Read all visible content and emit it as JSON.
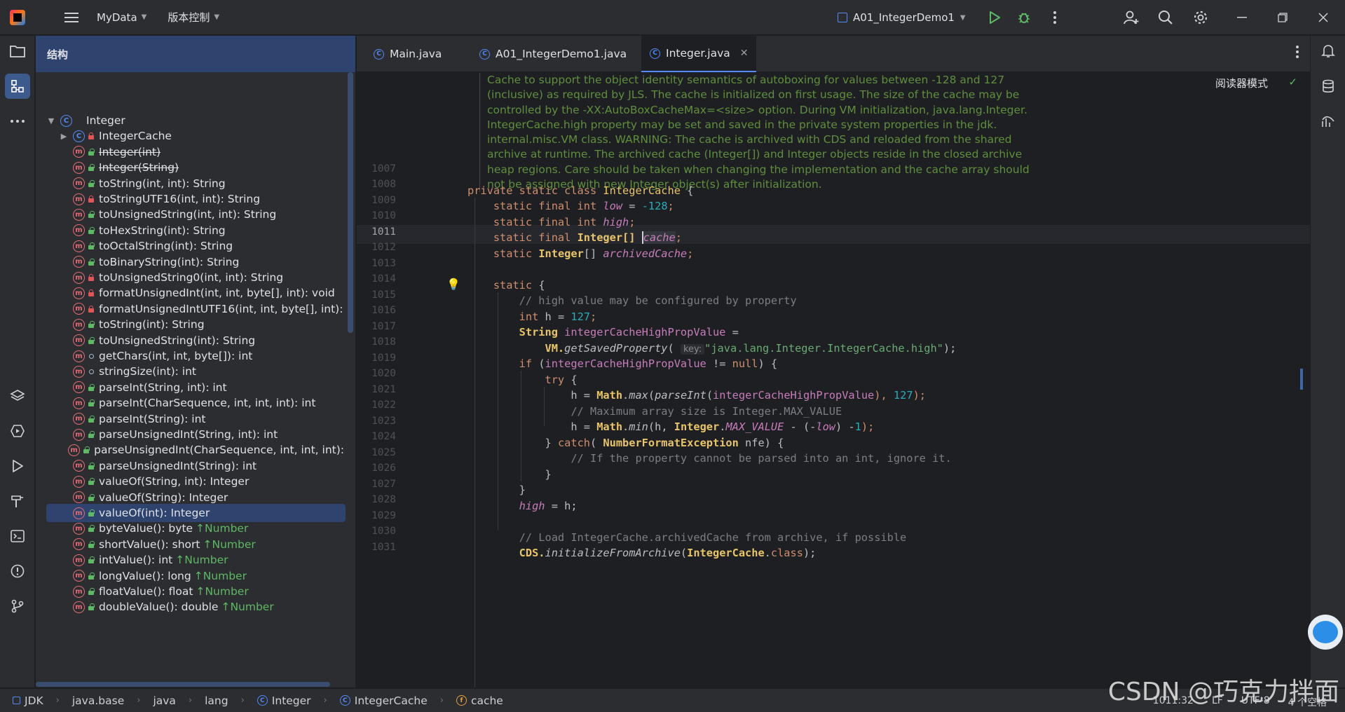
{
  "titlebar": {
    "project": "MyData",
    "vcs": "版本控制",
    "run_config": "A01_IntegerDemo1"
  },
  "structure": {
    "title": "结构",
    "items": [
      {
        "label": "Integer",
        "kind": "c",
        "vis": "",
        "arrow": "open",
        "indent": 0
      },
      {
        "label": "IntegerCache",
        "kind": "c",
        "vis": "priv",
        "arrow": "closed",
        "indent": 1
      },
      {
        "label": "Integer(int)",
        "kind": "m",
        "vis": "pub",
        "strike": true,
        "indent": 1
      },
      {
        "label": "Integer(String)",
        "kind": "m",
        "vis": "pub",
        "strike": true,
        "indent": 1
      },
      {
        "label": "toString(int, int): String",
        "kind": "m",
        "vis": "pub",
        "indent": 1
      },
      {
        "label": "toStringUTF16(int, int): String",
        "kind": "m",
        "vis": "priv",
        "indent": 1
      },
      {
        "label": "toUnsignedString(int, int): String",
        "kind": "m",
        "vis": "pub",
        "indent": 1
      },
      {
        "label": "toHexString(int): String",
        "kind": "m",
        "vis": "pub",
        "indent": 1
      },
      {
        "label": "toOctalString(int): String",
        "kind": "m",
        "vis": "pub",
        "indent": 1
      },
      {
        "label": "toBinaryString(int): String",
        "kind": "m",
        "vis": "pub",
        "indent": 1
      },
      {
        "label": "toUnsignedString0(int, int): String",
        "kind": "m",
        "vis": "priv",
        "indent": 1
      },
      {
        "label": "formatUnsignedInt(int, int, byte[], int): void",
        "kind": "m",
        "vis": "priv",
        "indent": 1
      },
      {
        "label": "formatUnsignedIntUTF16(int, int, byte[], int):",
        "kind": "m",
        "vis": "priv",
        "indent": 1
      },
      {
        "label": "toString(int): String",
        "kind": "m",
        "vis": "pub",
        "indent": 1
      },
      {
        "label": "toUnsignedString(int): String",
        "kind": "m",
        "vis": "pub",
        "indent": 1
      },
      {
        "label": "getChars(int, int, byte[]): int",
        "kind": "m",
        "vis": "pkg",
        "indent": 1
      },
      {
        "label": "stringSize(int): int",
        "kind": "m",
        "vis": "pkg",
        "indent": 1
      },
      {
        "label": "parseInt(String, int): int",
        "kind": "m",
        "vis": "pub",
        "indent": 1
      },
      {
        "label": "parseInt(CharSequence, int, int, int): int",
        "kind": "m",
        "vis": "pub",
        "indent": 1
      },
      {
        "label": "parseInt(String): int",
        "kind": "m",
        "vis": "pub",
        "indent": 1
      },
      {
        "label": "parseUnsignedInt(String, int): int",
        "kind": "m",
        "vis": "pub",
        "indent": 1
      },
      {
        "label": "parseUnsignedInt(CharSequence, int, int, int):",
        "kind": "m",
        "vis": "pub",
        "indent": 1
      },
      {
        "label": "parseUnsignedInt(String): int",
        "kind": "m",
        "vis": "pub",
        "indent": 1
      },
      {
        "label": "valueOf(String, int): Integer",
        "kind": "m",
        "vis": "pub",
        "indent": 1
      },
      {
        "label": "valueOf(String): Integer",
        "kind": "m",
        "vis": "pub",
        "indent": 1
      },
      {
        "label": "valueOf(int): Integer",
        "kind": "m",
        "vis": "pub",
        "selected": true,
        "indent": 1
      },
      {
        "label": "byteValue(): byte",
        "super": "↑Number",
        "kind": "m",
        "vis": "pub",
        "indent": 1
      },
      {
        "label": "shortValue(): short",
        "super": "↑Number",
        "kind": "m",
        "vis": "pub",
        "indent": 1
      },
      {
        "label": "intValue(): int",
        "super": "↑Number",
        "kind": "m",
        "vis": "pub",
        "indent": 1
      },
      {
        "label": "longValue(): long",
        "super": "↑Number",
        "kind": "m",
        "vis": "pub",
        "indent": 1
      },
      {
        "label": "floatValue(): float",
        "super": "↑Number",
        "kind": "m",
        "vis": "pub",
        "indent": 1
      },
      {
        "label": "doubleValue(): double",
        "super": "↑Number",
        "kind": "m",
        "vis": "pub",
        "indent": 1
      }
    ]
  },
  "tabs": [
    {
      "label": "Main.java",
      "active": false
    },
    {
      "label": "A01_IntegerDemo1.java",
      "active": false
    },
    {
      "label": "Integer.java",
      "active": true
    }
  ],
  "editor": {
    "reader_mode": "阅读器模式",
    "doc_comment": [
      "Cache to support the object identity semantics of autoboxing for values between -128 and 127",
      "(inclusive) as required by JLS. The cache is initialized on first usage. The size of the cache may be",
      "controlled by the -XX:AutoBoxCacheMax=<size> option. During VM initialization, java.lang.Integer.",
      "IntegerCache.high property may be set and saved in the private system properties in the jdk.",
      "internal.misc.VM class. WARNING: The cache is archived with CDS and reloaded from the shared",
      "archive at runtime. The archived cache (Integer[]) and Integer objects reside in the closed archive",
      "heap regions. Care should be taken when changing the implementation and the cache array should",
      "not be assigned with new Integer object(s) after initialization."
    ],
    "line_numbers": [
      "1007",
      "1008",
      "1009",
      "1010",
      "1011",
      "1012",
      "1013",
      "1014",
      "1015",
      "1016",
      "1017",
      "1018",
      "1019",
      "1020",
      "1021",
      "1022",
      "1023",
      "1024",
      "1025",
      "1026",
      "1027",
      "1028",
      "1029",
      "1030",
      "1031"
    ],
    "current_line": "1011",
    "param_hint": "key:",
    "code": {
      "l1008_a": "private static class ",
      "l1008_b": "IntegerCache",
      "l1008_c": " {",
      "l1009_a": "    static final int ",
      "l1009_b": "low",
      "l1009_c": " = ",
      "l1009_d": "-128",
      "l1009_e": ";",
      "l1010_a": "    static final int ",
      "l1010_b": "high",
      "l1010_c": ";",
      "l1011_a": "    static final ",
      "l1011_b": "Integer[]",
      "l1011_c": " ",
      "l1011_d": "cache",
      "l1011_e": ";",
      "l1012_a": "    static ",
      "l1012_b": "Integer",
      "l1012_c": "[] ",
      "l1012_d": "archivedCache",
      "l1012_e": ";",
      "l1014_a": "    static",
      "l1014_b": " {",
      "l1015": "        // high value may be configured by property",
      "l1016_a": "        int",
      "l1016_b": " h = ",
      "l1016_c": "127",
      "l1016_d": ";",
      "l1017_a": "        String ",
      "l1017_b": "integerCacheHighPropValue",
      "l1017_c": " =",
      "l1018_a": "            VM.",
      "l1018_b": "getSavedProperty",
      "l1018_c": "( ",
      "l1018_d": "\"java.lang.Integer.IntegerCache.high\"",
      "l1018_e": ");",
      "l1019_a": "        if",
      "l1019_b": " (",
      "l1019_c": "integerCacheHighPropValue",
      "l1019_d": " != ",
      "l1019_e": "null",
      "l1019_f": ") {",
      "l1020_a": "            try",
      "l1020_b": " {",
      "l1021_a": "                h = ",
      "l1021_b": "Math",
      "l1021_c": ".",
      "l1021_d": "max",
      "l1021_e": "(",
      "l1021_f": "parseInt",
      "l1021_g": "(",
      "l1021_h": "integerCacheHighPropValue",
      "l1021_i": "), ",
      "l1021_j": "127",
      "l1021_k": ");",
      "l1022": "                // Maximum array size is Integer.MAX_VALUE",
      "l1023_a": "                h = ",
      "l1023_b": "Math",
      "l1023_c": ".",
      "l1023_d": "min",
      "l1023_e": "(h, ",
      "l1023_f": "Integer",
      "l1023_g": ".",
      "l1023_h": "MAX_VALUE",
      "l1023_i": " - (-",
      "l1023_j": "low",
      "l1023_k": ") -",
      "l1023_l": "1",
      "l1023_m": ");",
      "l1024_a": "            } ",
      "l1024_b": "catch",
      "l1024_c": "( ",
      "l1024_d": "NumberFormatException",
      "l1024_e": " nfe) {",
      "l1025": "                // If the property cannot be parsed into an int, ignore it.",
      "l1026": "            }",
      "l1027": "        }",
      "l1028_a": "        high",
      "l1028_b": " = h;",
      "l1030": "        // Load IntegerCache.archivedCache from archive, if possible",
      "l1031_a": "        CDS.",
      "l1031_b": "initializeFromArchive",
      "l1031_c": "(",
      "l1031_d": "IntegerCache",
      "l1031_e": ".",
      "l1031_f": "class",
      "l1031_g": ");"
    }
  },
  "statusbar": {
    "crumbs": [
      "JDK",
      "java.base",
      "java",
      "lang",
      "Integer",
      "IntegerCache",
      "cache"
    ],
    "position": "1011:32",
    "line_sep": "LF",
    "encoding": "UTF-8",
    "indent": "4 个空格"
  },
  "watermark": "CSDN @巧克力拌面",
  "colors": {
    "accent": "#548af7",
    "selection": "#2e436e",
    "comment": "#5f8f3e",
    "keyword": "#cf8e6d"
  }
}
